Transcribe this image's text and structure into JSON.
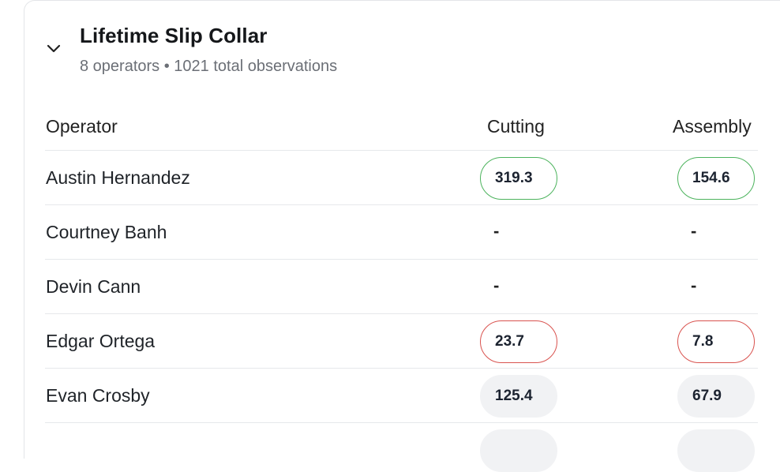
{
  "section": {
    "title": "Lifetime Slip Collar",
    "subtitle": "8 operators • 1021 total observations"
  },
  "table": {
    "columns": [
      "Operator",
      "Cutting",
      "Assembly"
    ],
    "rows": [
      {
        "operator": "Austin Hernandez",
        "cutting": "319.3",
        "cutting_status": "green",
        "assembly": "154.6",
        "assembly_status": "green"
      },
      {
        "operator": "Courtney Banh",
        "cutting": "-",
        "cutting_status": "none",
        "assembly": "-",
        "assembly_status": "none"
      },
      {
        "operator": "Devin Cann",
        "cutting": "-",
        "cutting_status": "none",
        "assembly": "-",
        "assembly_status": "none"
      },
      {
        "operator": "Edgar Ortega",
        "cutting": "23.7",
        "cutting_status": "red",
        "assembly": "7.8",
        "assembly_status": "red"
      },
      {
        "operator": "Evan Crosby",
        "cutting": "125.4",
        "cutting_status": "neutral",
        "assembly": "67.9",
        "assembly_status": "neutral"
      }
    ]
  },
  "colors": {
    "good": "#4cb35d",
    "bad": "#d9534f",
    "neutral_bg": "#f1f2f4"
  },
  "icons": {
    "collapse": "chevron-down-icon"
  }
}
